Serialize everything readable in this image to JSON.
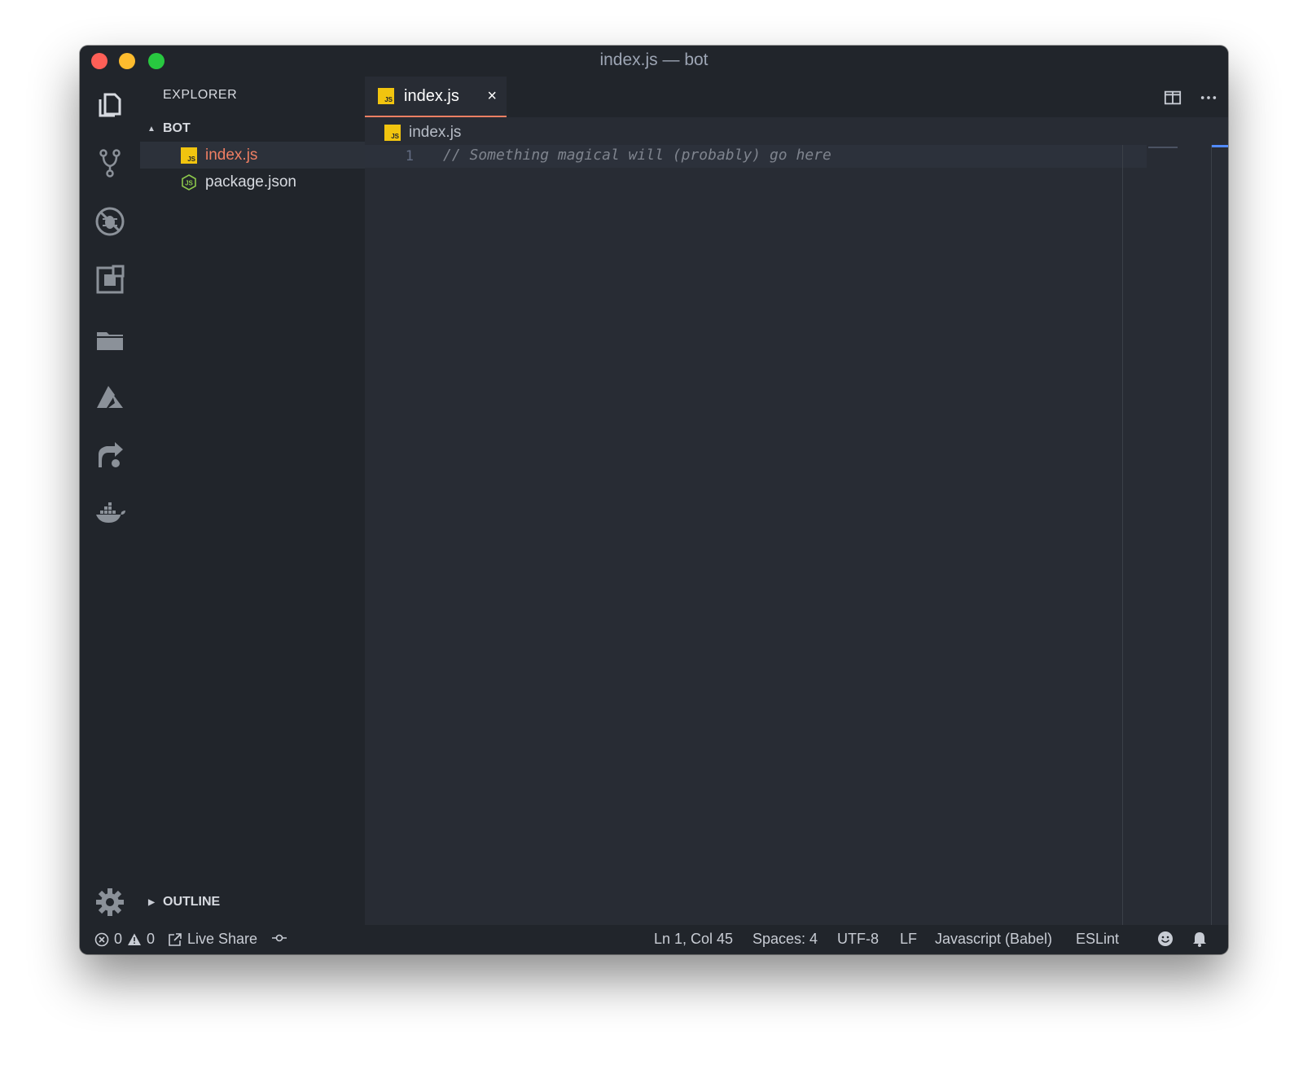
{
  "window": {
    "title": "index.js — bot"
  },
  "activity_bar": {
    "items": [
      "explorer-icon",
      "source-control-icon",
      "debug-icon",
      "extensions-icon",
      "remote-explorer-icon",
      "azure-icon",
      "live-share-icon",
      "docker-icon",
      "settings-gear-icon"
    ]
  },
  "sidebar": {
    "title": "EXPLORER",
    "folder": "BOT",
    "files": [
      {
        "name": "index.js",
        "icon": "js-file-icon"
      },
      {
        "name": "package.json",
        "icon": "node-file-icon"
      }
    ],
    "outline": "OUTLINE"
  },
  "editor": {
    "tab": {
      "label": "index.js",
      "close": "×"
    },
    "breadcrumb": "index.js",
    "lines": [
      {
        "number": "1",
        "text": "// Something magical will (probably) go here"
      }
    ],
    "actions": [
      "split-editor-icon",
      "more-icon"
    ]
  },
  "status_bar": {
    "errors": "0",
    "warnings": "0",
    "live_share": "Live Share",
    "position": "Ln 1, Col 45",
    "spaces": "Spaces: 4",
    "encoding": "UTF-8",
    "eol": "LF",
    "language": "Javascript (Babel)",
    "linter": "ESLint"
  },
  "colors": {
    "accent": "#ef7f63",
    "editor_bg": "#282c34",
    "sidebar_bg": "#21252b",
    "js_icon": "#f1c40f"
  }
}
